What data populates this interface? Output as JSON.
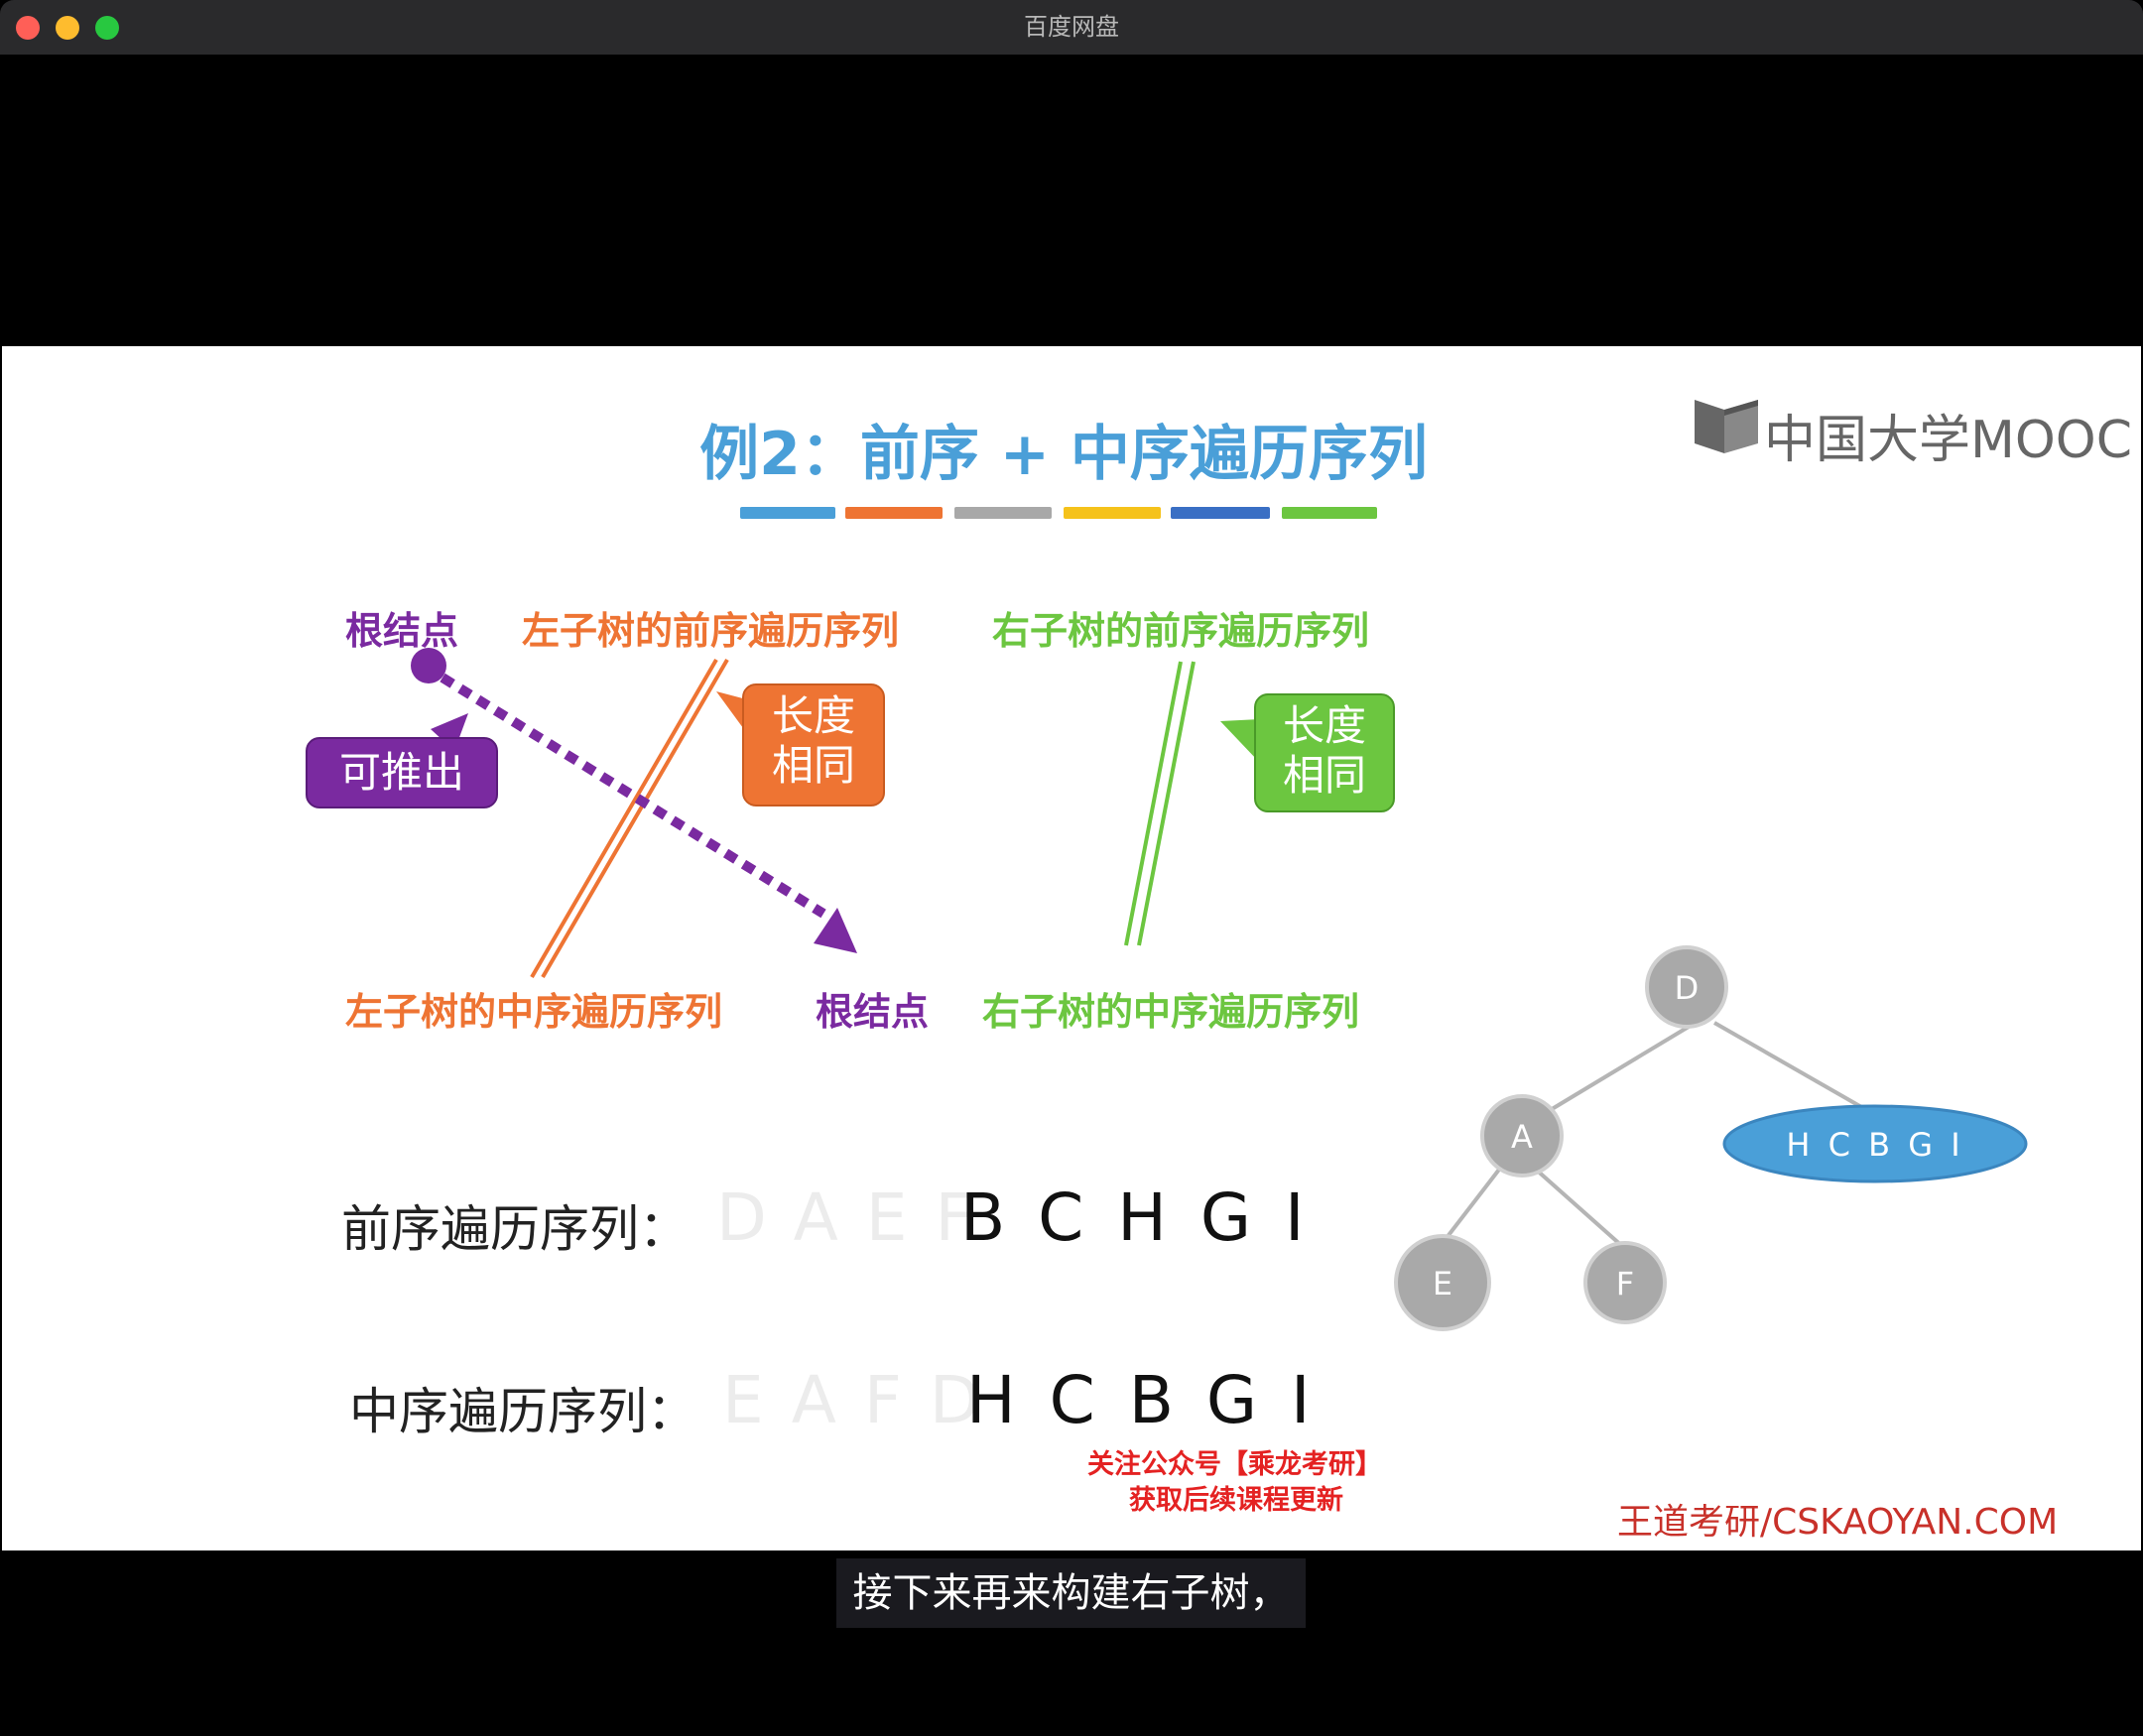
{
  "window": {
    "title": "百度网盘"
  },
  "slide": {
    "title": "例2：前序 + 中序遍历序列",
    "color_bars": [
      "#4a9fd8",
      "#ee7433",
      "#a8a8a8",
      "#f5c21b",
      "#3a6fc4",
      "#6cc640"
    ],
    "logo": "中国大学MOOC",
    "labels": {
      "root_top": "根结点",
      "left_preorder": "左子树的前序遍历序列",
      "right_preorder": "右子树的前序遍历序列",
      "left_inorder": "左子树的中序遍历序列",
      "root_bottom": "根结点",
      "right_inorder": "右子树的中序遍历序列"
    },
    "callouts": {
      "infer": "可推出",
      "same_len_orange_1": "长度",
      "same_len_orange_2": "相同",
      "same_len_green_1": "长度",
      "same_len_green_2": "相同"
    },
    "sequences": {
      "preorder_label": "前序遍历序列：",
      "preorder_faded": "DAEF",
      "preorder_active": "BCHGI",
      "inorder_label": "中序遍历序列：",
      "inorder_faded": "EAFD",
      "inorder_active": "HCBGI"
    },
    "tree": {
      "root": "D",
      "left": "A",
      "left_left": "E",
      "left_right": "F",
      "right_subtree": "H C B G I"
    },
    "promo_line1": "关注公众号【乘龙考研】",
    "promo_line2": "获取后续课程更新",
    "site": "王道考研/CSKAOYAN.COM"
  },
  "subtitle": "接下来再来构建右子树，"
}
